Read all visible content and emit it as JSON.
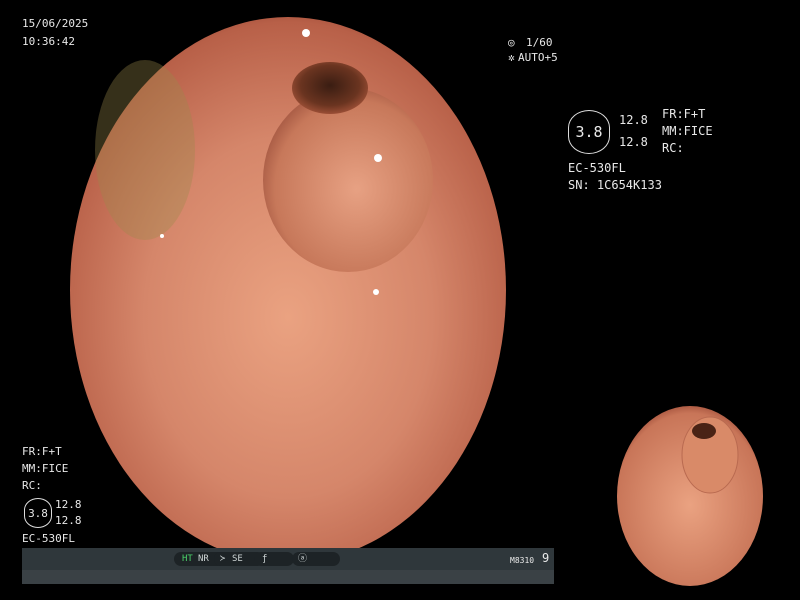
{
  "header": {
    "date": "15/06/2025",
    "time": "10:36:42"
  },
  "exposure": {
    "shutter": "1/60",
    "auto": "AUTO+5"
  },
  "info_panel": {
    "badge": "3.8",
    "value_top": "12.8",
    "value_bottom": "12.8",
    "fr": "FR:F+T",
    "mm": "MM:FICE",
    "rc": "RC:",
    "model": "EC-530FL",
    "serial": "SN: 1C654K133"
  },
  "left_panel": {
    "fr": "FR:F+T",
    "mm": "MM:FICE",
    "rc": "RC:",
    "badge": "3.8",
    "value_top": "12.8",
    "value_bottom": "12.8",
    "model": "EC-530FL"
  },
  "status_bar": {
    "ht": "HT",
    "nr": "NR",
    "se": "SE",
    "code": "M8310",
    "number": "9"
  },
  "colors": {
    "tissue": "#d98a68",
    "lumen": "#5a2a1a",
    "status_green": "#4bd26a"
  }
}
